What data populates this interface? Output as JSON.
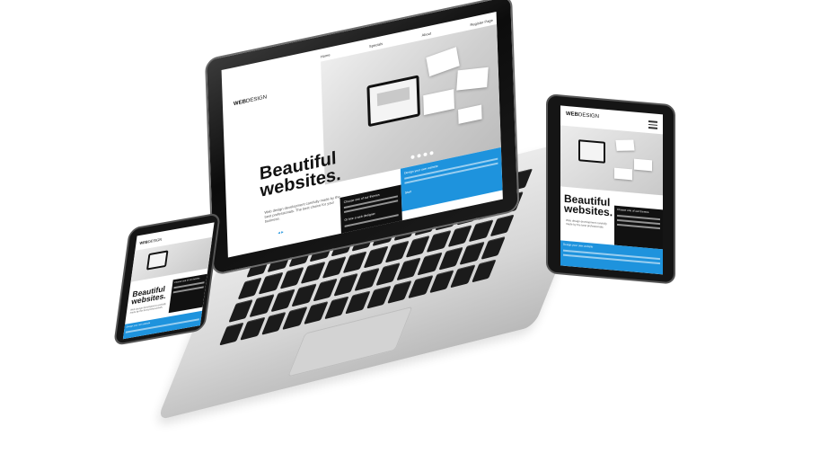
{
  "laptop": {
    "nav": [
      "Home",
      "Specials",
      "About",
      "Register Page"
    ],
    "brand_bold": "WEB",
    "brand_thin": "DESIGN",
    "headline_line1": "Beautiful",
    "headline_line2": "websites.",
    "blurb": "Web design development carefully made by the best professionals. The best choice for your business.",
    "arrows": "◂ ▸",
    "dark_box_title": "Choose one of our themes",
    "dark_box_sub": "Or hire a web designer",
    "blue_box_title": "Design your own website",
    "blue_box_button": "Start"
  },
  "tablet": {
    "brand_bold": "WEB",
    "brand_thin": "DESIGN",
    "headline_line1": "Beautiful",
    "headline_line2": "websites.",
    "blurb": "Web design development carefully made by the best professionals.",
    "dark_box_title": "Choose one of our themes",
    "blue_box_title": "Design your own website"
  },
  "phone": {
    "brand_bold": "WEB",
    "brand_thin": "DESIGN",
    "headline_line1": "Beautiful",
    "headline_line2": "websites.",
    "blurb": "Web design development carefully made by the best professionals.",
    "dark_box_title": "Choose one of our themes",
    "blue_box_title": "Design your own website"
  },
  "colors": {
    "accent_blue": "#1e93dd",
    "device_black": "#151515",
    "laptop_silver": "#d6d6d6"
  }
}
